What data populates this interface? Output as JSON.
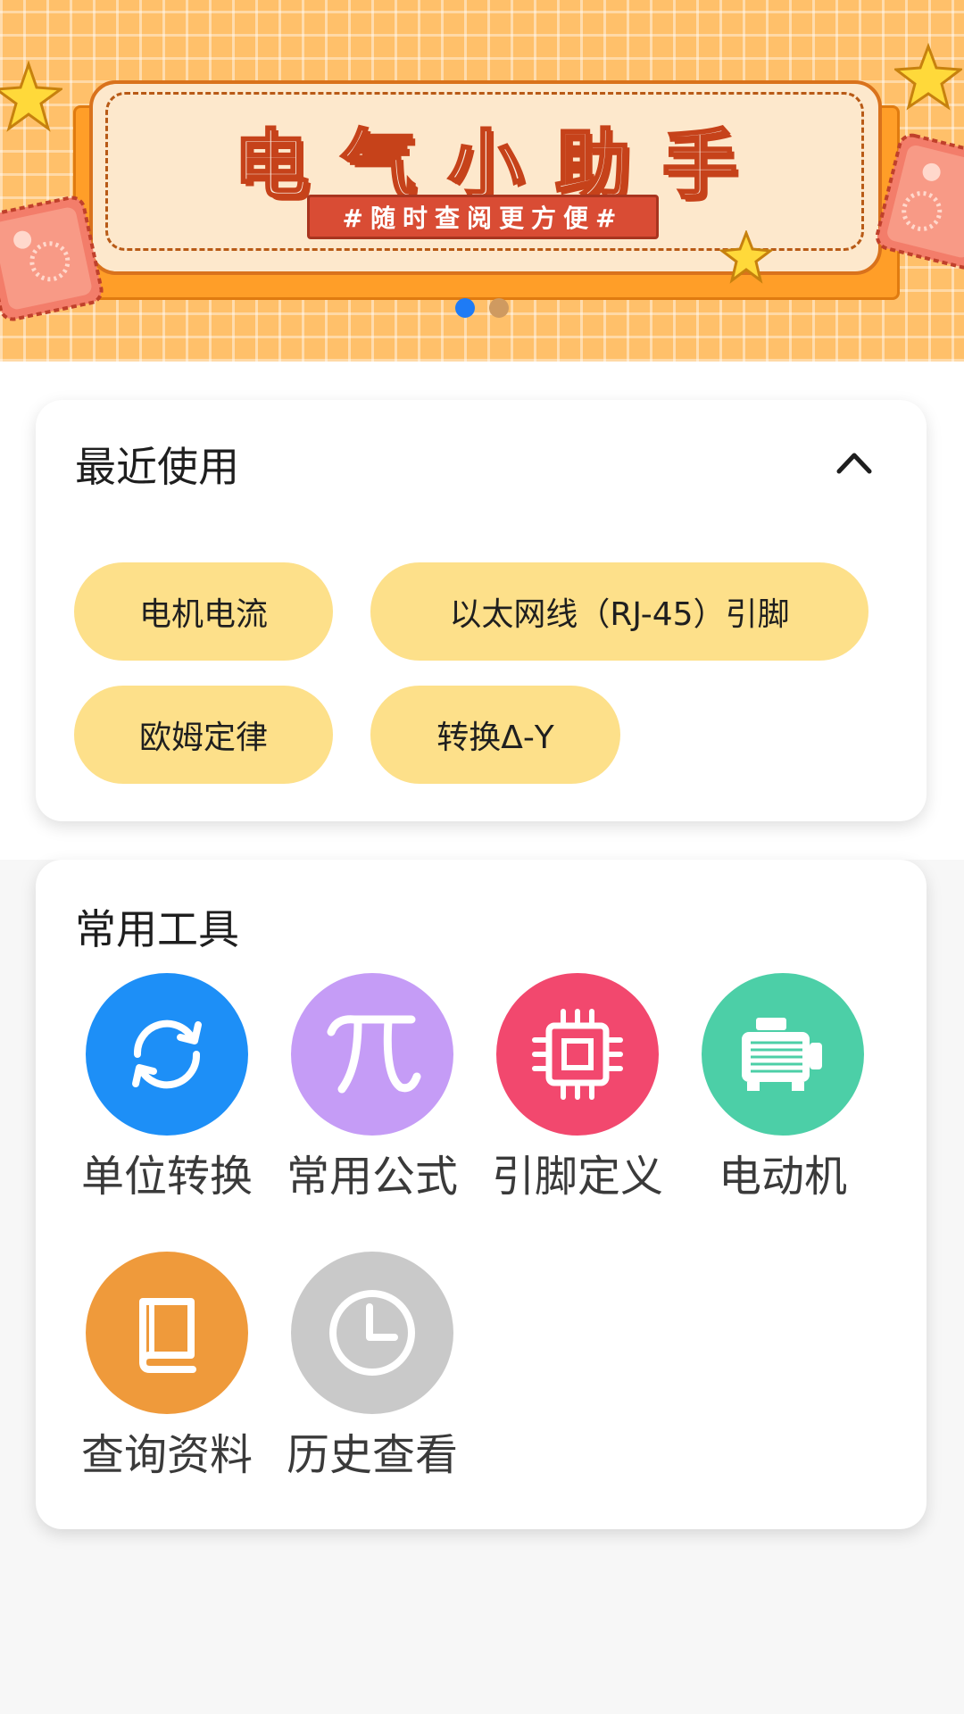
{
  "banner": {
    "title": "电气小助手",
    "subtitle": "#随时查阅更方便#",
    "slide_count": 2,
    "active_slide": 1
  },
  "recent": {
    "title": "最近使用",
    "collapse_icon": "chevron-up-icon",
    "chips": [
      {
        "label": "电机电流"
      },
      {
        "label": "以太网线（RJ-45）引脚"
      },
      {
        "label": "欧姆定律"
      },
      {
        "label": "转换Δ-Y"
      }
    ]
  },
  "tools": {
    "title": "常用工具",
    "items": [
      {
        "label": "单位转换",
        "icon": "refresh-icon",
        "color": "#1d8ff7"
      },
      {
        "label": "常用公式",
        "icon": "pi-icon",
        "color": "#c59cf6"
      },
      {
        "label": "引脚定义",
        "icon": "chip-icon",
        "color": "#f2486e"
      },
      {
        "label": "电动机",
        "icon": "motor-icon",
        "color": "#4ccfa7"
      },
      {
        "label": "查询资料",
        "icon": "book-icon",
        "color": "#ef9a3b"
      },
      {
        "label": "历史查看",
        "icon": "clock-icon",
        "color": "#c9c9c9"
      }
    ]
  },
  "colors": {
    "accent": "#1e7bf5",
    "chip": "#fde08a",
    "banner_bg": "#ffc06a"
  }
}
